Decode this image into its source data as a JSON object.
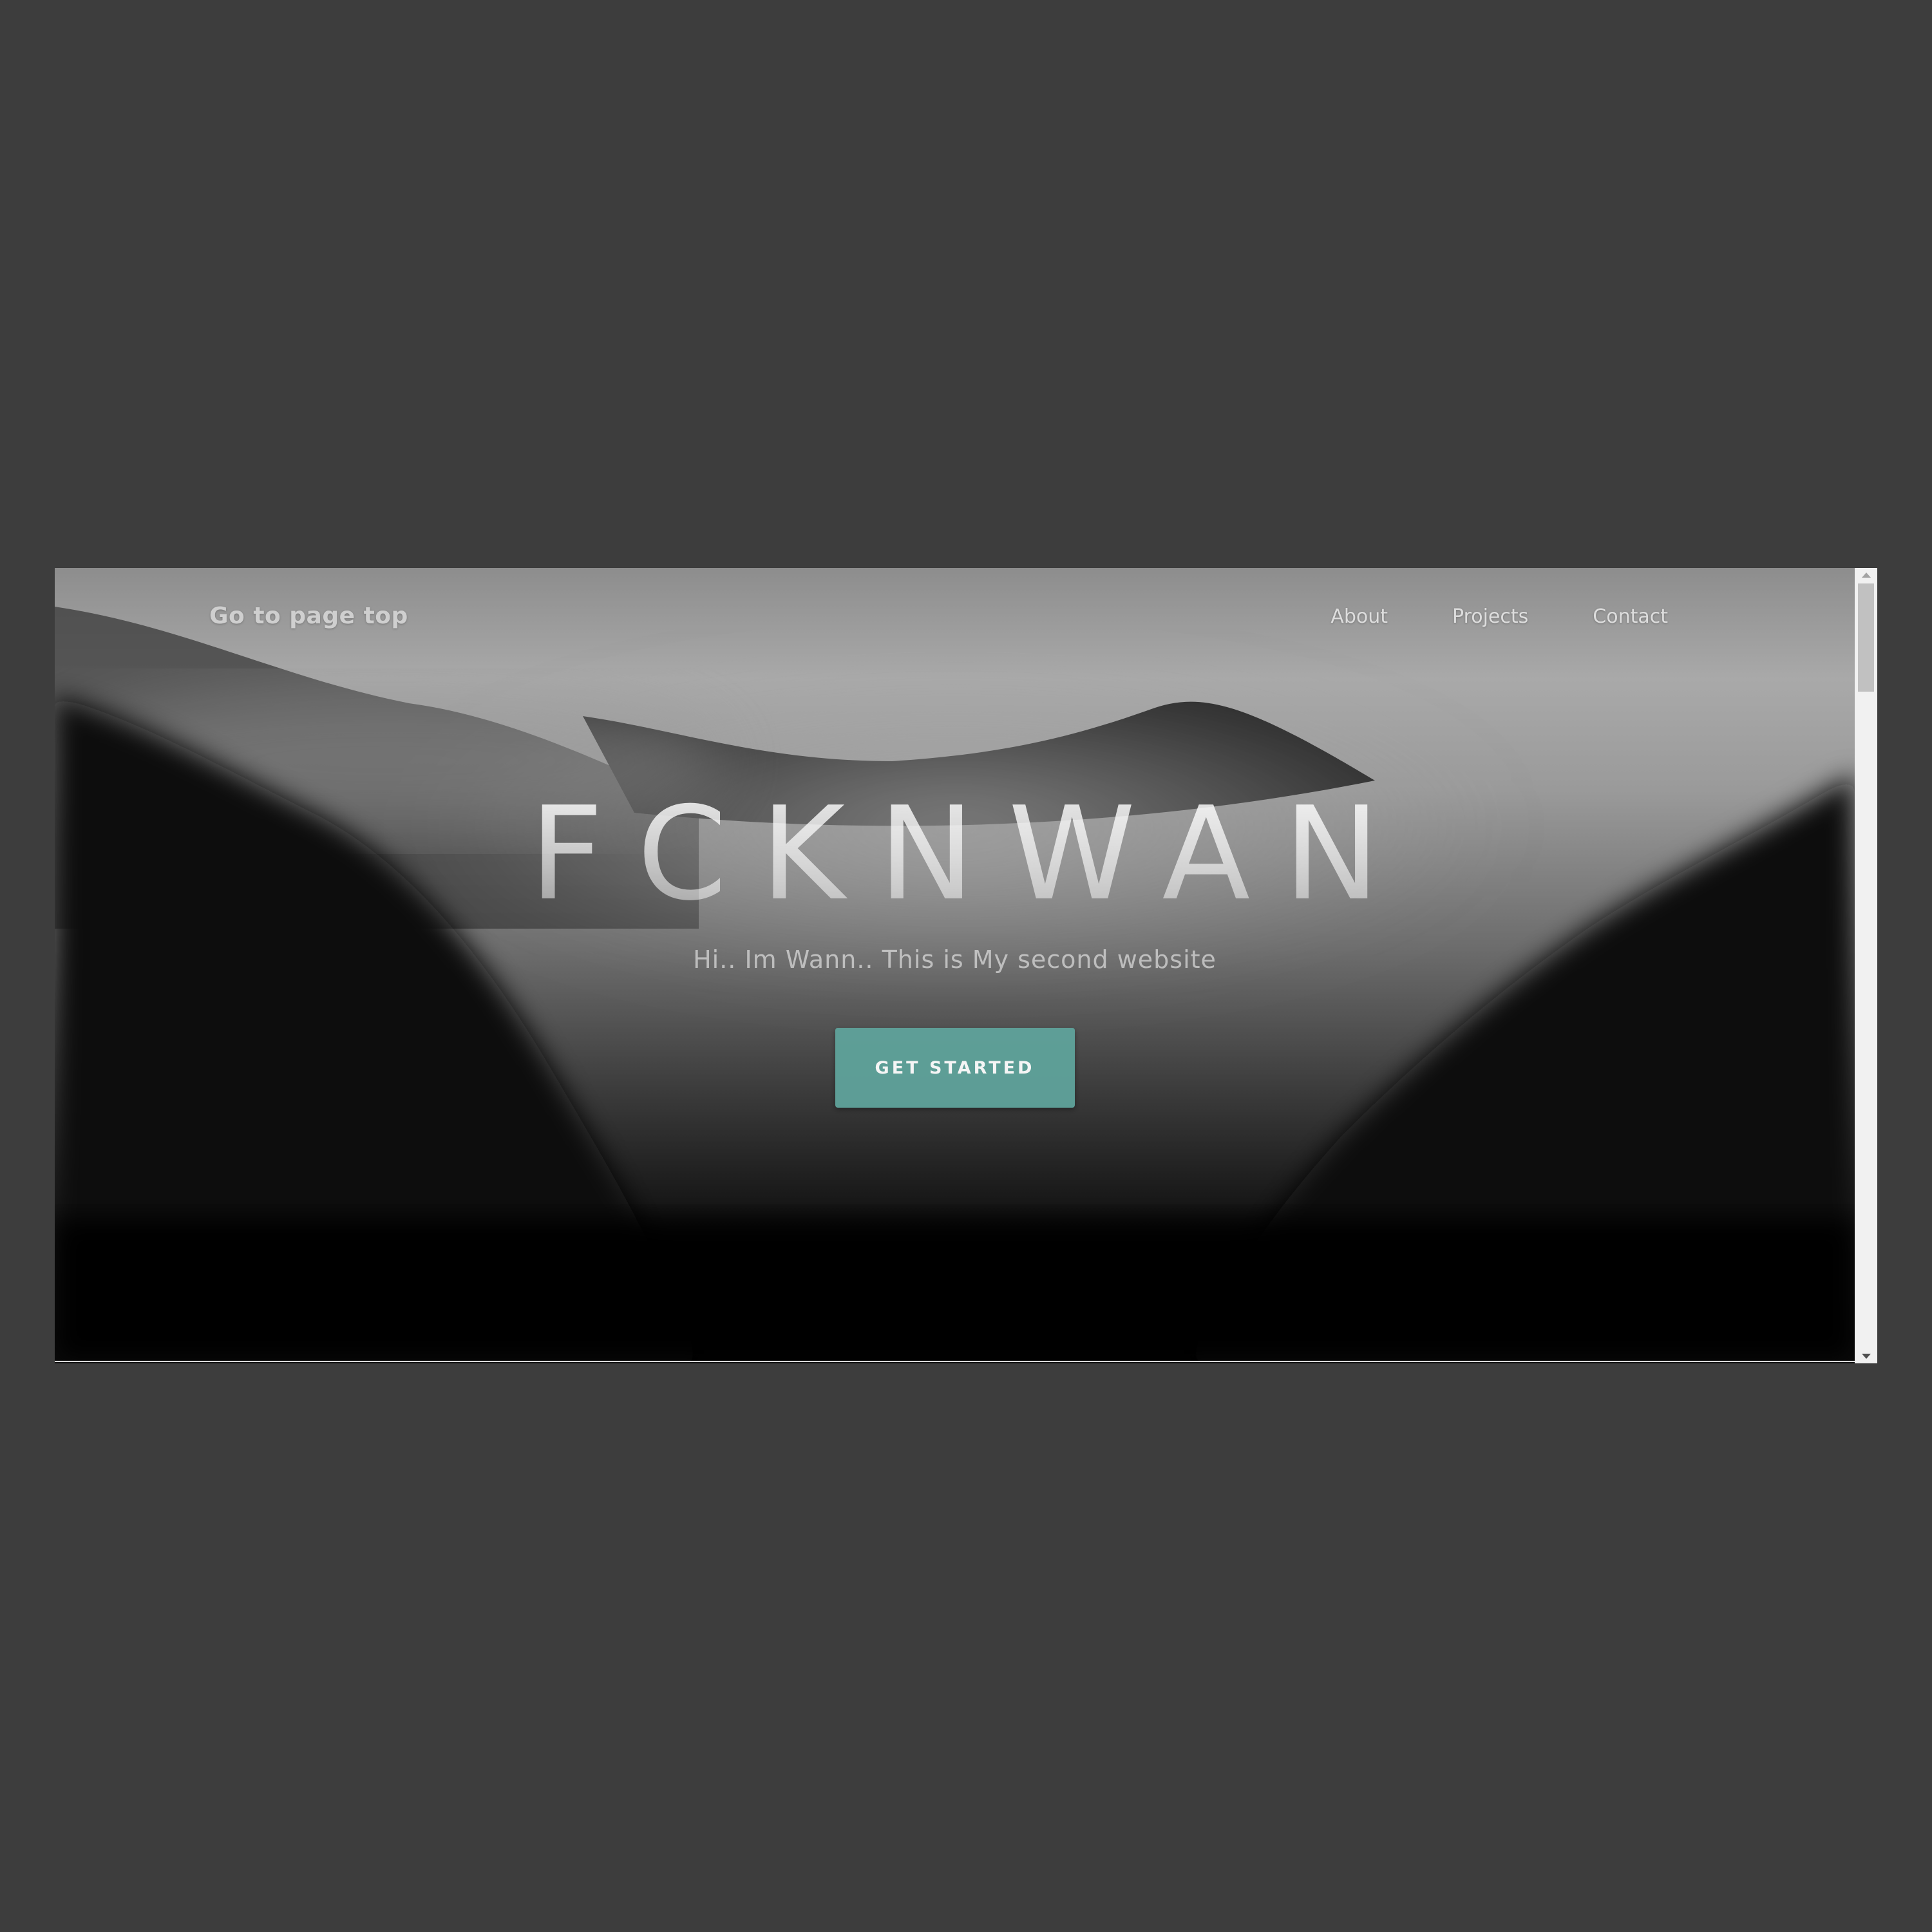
{
  "nav": {
    "brand": "Go to page top",
    "links": [
      {
        "label": "About"
      },
      {
        "label": "Projects"
      },
      {
        "label": "Contact"
      }
    ]
  },
  "hero": {
    "title": "FCKNWAN",
    "subtitle": "Hi.. Im Wann.. This is My second website",
    "cta_label": "GET STARTED"
  },
  "colors": {
    "page_background": "#3d3d3d",
    "accent_button": "#5fa39b",
    "text_light": "#dddddd"
  },
  "background_image": "misty-mountain-forest-photo"
}
